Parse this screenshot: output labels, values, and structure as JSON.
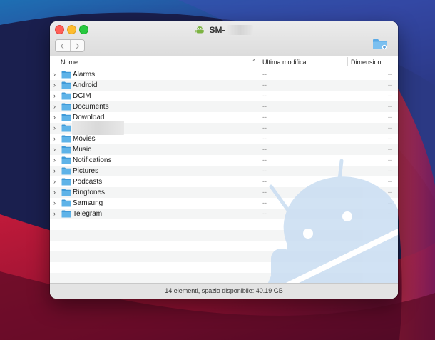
{
  "window": {
    "title": "SM-",
    "title_icon": "android-device-icon"
  },
  "toolbar": {
    "back_icon": "chevron-left-icon",
    "forward_icon": "chevron-right-icon",
    "new_folder_icon": "new-folder-icon"
  },
  "columns": {
    "name": "Nome",
    "modified": "Ultima modifica",
    "size": "Dimensioni"
  },
  "rows": [
    {
      "name": "Alarms",
      "modified": "--",
      "size": "--"
    },
    {
      "name": "Android",
      "modified": "--",
      "size": "--"
    },
    {
      "name": "DCIM",
      "modified": "--",
      "size": "--"
    },
    {
      "name": "Documents",
      "modified": "--",
      "size": "--"
    },
    {
      "name": "Download",
      "modified": "--",
      "size": "--"
    },
    {
      "name": "",
      "modified": "--",
      "size": "--"
    },
    {
      "name": "Movies",
      "modified": "--",
      "size": "--"
    },
    {
      "name": "Music",
      "modified": "--",
      "size": "--"
    },
    {
      "name": "Notifications",
      "modified": "--",
      "size": "--"
    },
    {
      "name": "Pictures",
      "modified": "--",
      "size": "--"
    },
    {
      "name": "Podcasts",
      "modified": "--",
      "size": "--"
    },
    {
      "name": "Ringtones",
      "modified": "--",
      "size": "--"
    },
    {
      "name": "Samsung",
      "modified": "--",
      "size": "--"
    },
    {
      "name": "Telegram",
      "modified": "--",
      "size": "--"
    }
  ],
  "status": "14 elementi, spazio disponibile: 40.19 GB",
  "colors": {
    "folder": "#5eb3e8",
    "row_alt": "#f4f5f5",
    "watermark": "#c9ddf2"
  }
}
